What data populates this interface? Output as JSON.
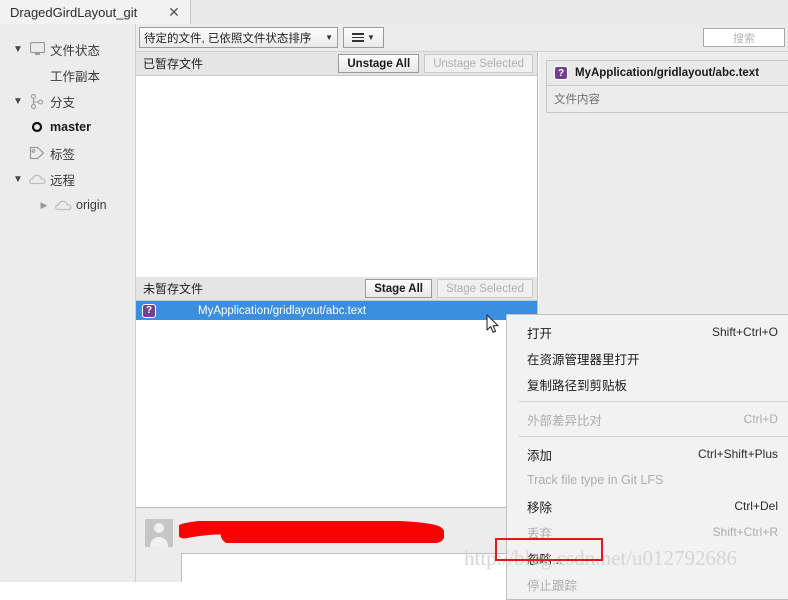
{
  "tab": {
    "label": "DragedGirdLayout_git",
    "close_icon": "close-icon"
  },
  "sidebar": {
    "items": [
      {
        "label": "文件状态",
        "icon": "monitor-icon",
        "chevron": "chevron-down",
        "level": 0,
        "bold": false
      },
      {
        "label": "工作副本",
        "icon": "",
        "chevron": "",
        "level": 1,
        "bold": false
      },
      {
        "label": "分支",
        "icon": "branch-icon",
        "chevron": "chevron-down",
        "level": 0,
        "bold": false
      },
      {
        "label": "master",
        "icon": "circle-icon",
        "chevron": "",
        "level": 1,
        "bold": true
      },
      {
        "label": "标签",
        "icon": "tag-icon",
        "chevron": "",
        "level": 0,
        "bold": false
      },
      {
        "label": "远程",
        "icon": "cloud-icon",
        "chevron": "chevron-down",
        "level": 0,
        "bold": false
      },
      {
        "label": "origin",
        "icon": "cloud-icon",
        "chevron": "chevron-right",
        "level": 2,
        "bold": false
      }
    ]
  },
  "toolbar": {
    "filter_value": "待定的文件, 已依照文件状态排序",
    "view_button_icon": "list-view-icon",
    "search_placeholder": "搜索"
  },
  "staged": {
    "title": "已暂存文件",
    "unstage_all": "Unstage All",
    "unstage_selected": "Unstage Selected",
    "files": []
  },
  "unstaged": {
    "title": "未暂存文件",
    "stage_all": "Stage All",
    "stage_selected": "Stage Selected",
    "files": [
      {
        "name": "MyApplication/gridlayout/abc.text",
        "status": "?",
        "selected": true
      }
    ]
  },
  "preview": {
    "file_name": "MyApplication/gridlayout/abc.text",
    "status": "?",
    "body_text": "文件内容"
  },
  "commit": {
    "author_redacted": true,
    "message": ""
  },
  "context_menu": {
    "items": [
      {
        "label": "打开",
        "shortcut": "Shift+Ctrl+O",
        "disabled": false,
        "separator_after": false
      },
      {
        "label": "在资源管理器里打开",
        "shortcut": "",
        "disabled": false,
        "separator_after": false
      },
      {
        "label": "复制路径到剪贴板",
        "shortcut": "",
        "disabled": false,
        "separator_after": true
      },
      {
        "label": "外部差异比对",
        "shortcut": "Ctrl+D",
        "disabled": true,
        "separator_after": true
      },
      {
        "label": "添加",
        "shortcut": "Ctrl+Shift+Plus",
        "disabled": false,
        "separator_after": false
      },
      {
        "label": "Track file type in Git LFS",
        "shortcut": "",
        "disabled": true,
        "separator_after": false
      },
      {
        "label": "移除",
        "shortcut": "Ctrl+Del",
        "disabled": false,
        "separator_after": false
      },
      {
        "label": "丢弃",
        "shortcut": "Shift+Ctrl+R",
        "disabled": true,
        "separator_after": false
      },
      {
        "label": "忽略...",
        "shortcut": "",
        "disabled": false,
        "separator_after": false
      },
      {
        "label": "停止跟踪",
        "shortcut": "",
        "disabled": true,
        "separator_after": false
      }
    ],
    "highlighted_item": "忽略..."
  },
  "watermark": "http://blog.csdn.net/u012792686",
  "colors": {
    "selection_blue": "#3c8ede",
    "status_badge_purple": "#73408f",
    "highlight_red": "#e01a1a",
    "redaction_red": "#fb0000",
    "chrome_gray": "#ececec"
  }
}
